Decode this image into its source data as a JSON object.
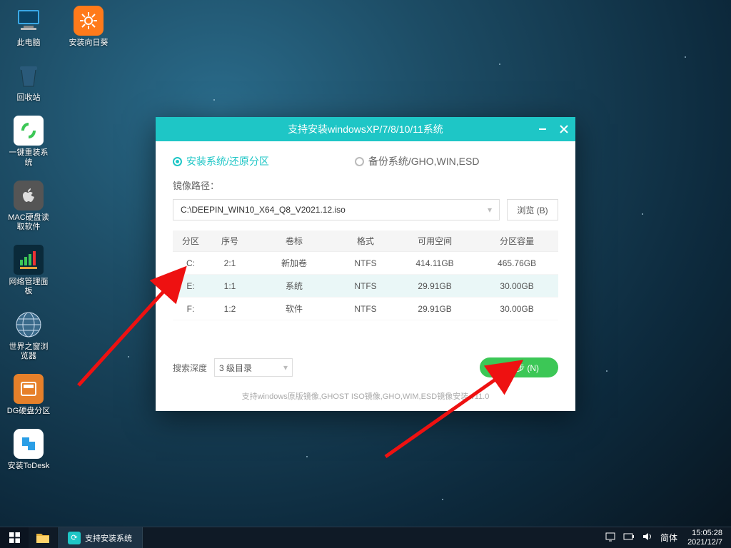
{
  "desktop_icons": [
    {
      "name": "this-pc",
      "label": "此电脑"
    },
    {
      "name": "recycle-bin",
      "label": "回收站"
    },
    {
      "name": "reinstall-system",
      "label": "一键重装系统"
    },
    {
      "name": "mac-disk-reader",
      "label": "MAC硬盘读取软件"
    },
    {
      "name": "network-panel",
      "label": "网络管理面板"
    },
    {
      "name": "world-browser",
      "label": "世界之窗浏览器"
    },
    {
      "name": "dg-partition",
      "label": "DG硬盘分区"
    },
    {
      "name": "install-todesk",
      "label": "安装ToDesk"
    },
    {
      "name": "install-sunflower",
      "label": "安装向日葵"
    }
  ],
  "window": {
    "title": "支持安装windowsXP/7/8/10/11系统",
    "radio_install": "安装系统/还原分区",
    "radio_backup": "备份系统/GHO,WIN,ESD",
    "path_label": "镜像路径：",
    "path_value": "C:\\DEEPIN_WIN10_X64_Q8_V2021.12.iso",
    "browse": "浏览 (B)",
    "columns": {
      "part": "分区",
      "idx": "序号",
      "vol": "卷标",
      "fs": "格式",
      "free": "可用空间",
      "cap": "分区容量"
    },
    "rows": [
      {
        "part": "C:",
        "idx": "2:1",
        "vol": "新加卷",
        "fs": "NTFS",
        "free": "414.11GB",
        "cap": "465.76GB"
      },
      {
        "part": "E:",
        "idx": "1:1",
        "vol": "系统",
        "fs": "NTFS",
        "free": "29.91GB",
        "cap": "30.00GB"
      },
      {
        "part": "F:",
        "idx": "1:2",
        "vol": "软件",
        "fs": "NTFS",
        "free": "29.91GB",
        "cap": "30.00GB"
      }
    ],
    "depth_label": "搜索深度",
    "depth_value": "3 级目录",
    "next": "下一步 (N)",
    "hint": "支持windows原版镜像,GHOST ISO镜像,GHO,WIM,ESD镜像安装   v11.0"
  },
  "taskbar": {
    "task_label": "支持安装系统",
    "ime": "简体",
    "time": "15:05:28",
    "date": "2021/12/7"
  }
}
